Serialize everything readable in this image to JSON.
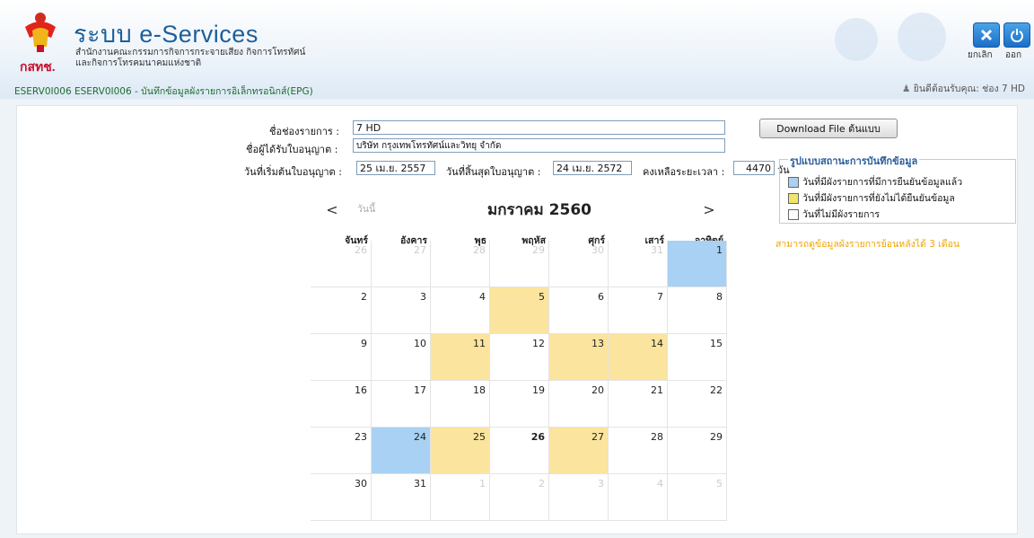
{
  "header": {
    "app_title": "ระบบ e-Services",
    "org_line1": "สำนักงานคณะกรรมการกิจการกระจายเสียง กิจการโทรทัศน์",
    "org_line2": "และกิจการโทรคมนาคมแห่งชาติ",
    "logo_text": "กสทช.",
    "breadcrumb": "ESERV0I006  ESERV0I006 - บันทึกข้อมูลผังรายการอิเล็กทรอนิกส์(EPG)",
    "cancel_label": "ยกเลิก",
    "exit_label": "ออก",
    "welcome": "ยินดีต้อนรับคุณ: ช่อง 7 HD"
  },
  "form": {
    "channel_label": "ชื่อช่องรายการ :",
    "channel_value": "7 HD",
    "licensee_label": "ชื่อผู้ได้รับใบอนุญาต :",
    "licensee_value": "บริษัท กรุงเทพโทรทัศน์และวิทยุ จำกัด",
    "start_label": "วันที่เริ่มต้นใบอนุญาต :",
    "start_value": "25 เม.ย. 2557",
    "end_label": "วันที่สิ้นสุดใบอนุญาต :",
    "end_value": "24 เม.ย. 2572",
    "remain_label": "คงเหลือระยะเวลา :",
    "remain_value": "4470",
    "remain_unit": "วัน"
  },
  "download_label": "Download File ต้นแบบ",
  "legend": {
    "title": "รูปแบบสถานะการบันทึกข้อมูล",
    "items": [
      "วันที่มีผังรายการที่มีการยืนยันข้อมูลแล้ว",
      "วันที่มีผังรายการที่ยังไม่ได้ยืนยันข้อมูล",
      "วันที่ไม่มีผังรายการ"
    ],
    "colors": [
      "#a8d1f3",
      "#f2e56b",
      "#ffffff"
    ]
  },
  "note": "สามารถดูข้อมูลผังรายการย้อนหลังได้ 3 เดือน",
  "calendar": {
    "prev": "<",
    "next": ">",
    "today": "วันนี้",
    "month": "มกราคม 2560",
    "days": [
      "จันทร์",
      "อังคาร",
      "พุธ",
      "พฤหัส",
      "ศุกร์",
      "เสาร์",
      "อาทิตย์"
    ],
    "weeks": [
      [
        {
          "d": "26",
          "o": true
        },
        {
          "d": "27",
          "o": true
        },
        {
          "d": "28",
          "o": true
        },
        {
          "d": "29",
          "o": true
        },
        {
          "d": "30",
          "o": true
        },
        {
          "d": "31",
          "o": true
        },
        {
          "d": "1",
          "s": "blue"
        }
      ],
      [
        {
          "d": "2"
        },
        {
          "d": "3"
        },
        {
          "d": "4"
        },
        {
          "d": "5",
          "s": "yellow"
        },
        {
          "d": "6"
        },
        {
          "d": "7"
        },
        {
          "d": "8"
        }
      ],
      [
        {
          "d": "9"
        },
        {
          "d": "10"
        },
        {
          "d": "11",
          "s": "yellow"
        },
        {
          "d": "12"
        },
        {
          "d": "13",
          "s": "yellow"
        },
        {
          "d": "14",
          "s": "yellow"
        },
        {
          "d": "15"
        }
      ],
      [
        {
          "d": "16"
        },
        {
          "d": "17"
        },
        {
          "d": "18"
        },
        {
          "d": "19"
        },
        {
          "d": "20"
        },
        {
          "d": "21"
        },
        {
          "d": "22"
        }
      ],
      [
        {
          "d": "23"
        },
        {
          "d": "24",
          "s": "blue"
        },
        {
          "d": "25",
          "s": "yellow"
        },
        {
          "d": "26",
          "b": true
        },
        {
          "d": "27",
          "s": "yellow"
        },
        {
          "d": "28"
        },
        {
          "d": "29"
        }
      ],
      [
        {
          "d": "30"
        },
        {
          "d": "31"
        },
        {
          "d": "1",
          "o": true
        },
        {
          "d": "2",
          "o": true
        },
        {
          "d": "3",
          "o": true
        },
        {
          "d": "4",
          "o": true
        },
        {
          "d": "5",
          "o": true
        }
      ]
    ]
  }
}
